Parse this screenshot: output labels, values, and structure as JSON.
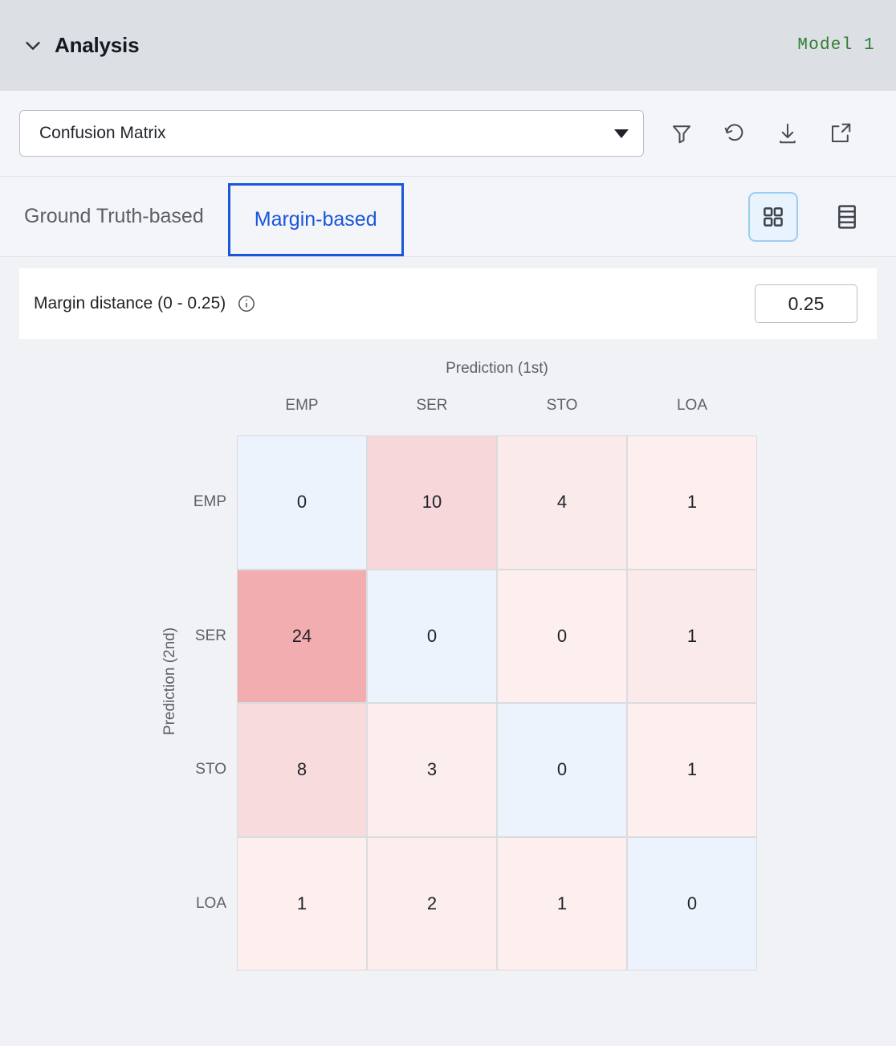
{
  "header": {
    "title": "Analysis",
    "chevron_icon": "chevron-down-icon",
    "model_label": "Model 1",
    "model_color": "#2f7d32"
  },
  "toolbar": {
    "select_value": "Confusion Matrix",
    "caret_icon": "caret-down-icon",
    "icons": [
      {
        "name": "filter-icon",
        "label": "Filter"
      },
      {
        "name": "reset-icon",
        "label": "Reset"
      },
      {
        "name": "download-icon",
        "label": "Download"
      },
      {
        "name": "expand-icon",
        "label": "Open in new window"
      }
    ]
  },
  "tabs": [
    {
      "label": "Ground Truth-based",
      "active": false
    },
    {
      "label": "Margin-based",
      "active": true
    }
  ],
  "view_toggle": [
    {
      "name": "grid-view-icon",
      "label": "Grid view",
      "selected": true
    },
    {
      "name": "table-view-icon",
      "label": "Table view",
      "selected": false
    }
  ],
  "margin": {
    "label": "Margin distance (0 - 0.25)",
    "info_icon": "info-icon",
    "value": "0.25"
  },
  "accent": {
    "tab_active": "#1a56db",
    "toggle_selected_bg": "#e8f3fd",
    "toggle_selected_border": "#9ccdf5"
  },
  "chart_data": {
    "type": "heatmap",
    "title": "",
    "xlabel": "Prediction (1st)",
    "ylabel": "Prediction (2nd)",
    "categories": [
      "EMP",
      "SER",
      "STO",
      "LOA"
    ],
    "rows": [
      "EMP",
      "SER",
      "STO",
      "LOA"
    ],
    "columns": [
      "EMP",
      "SER",
      "STO",
      "LOA"
    ],
    "values": [
      [
        0,
        10,
        4,
        1
      ],
      [
        24,
        0,
        0,
        1
      ],
      [
        8,
        3,
        0,
        1
      ],
      [
        1,
        2,
        1,
        0
      ]
    ],
    "cell_colors": [
      [
        "#ecf3fc",
        "#f7d7da",
        "#faeae9",
        "#fcefed"
      ],
      [
        "#f2adb0",
        "#ecf3fc",
        "#fcefed",
        "#faeae9"
      ],
      [
        "#f8dbdd",
        "#fbeeec",
        "#ecf3fc",
        "#fcefed"
      ],
      [
        "#fcefed",
        "#fbeeec",
        "#fcefed",
        "#ecf3fc"
      ]
    ],
    "diagonal_color": "#ecf3fc",
    "max_value": 24,
    "grid": true,
    "legend_position": "none"
  }
}
